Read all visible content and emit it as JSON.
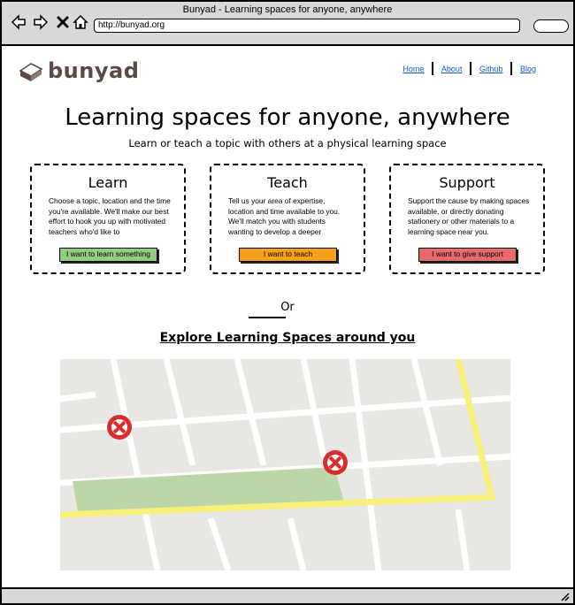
{
  "window": {
    "title": "Bunyad - Learning spaces for anyone, anywhere",
    "url": "http://bunyad.org"
  },
  "header": {
    "logo_text": "bunyad",
    "logo_color": "#5a4a45",
    "nav": [
      {
        "label": "Home"
      },
      {
        "label": "About"
      },
      {
        "label": "Github"
      },
      {
        "label": "Blog"
      }
    ],
    "link_color": "#1a56c9"
  },
  "hero": {
    "title": "Learning spaces for anyone, anywhere",
    "subtitle": "Learn or teach a topic with others at a physical learning space"
  },
  "cards": [
    {
      "title": "Learn",
      "body": "Choose a topic, location and the time you're available. We'll make our best effort to hook you up with motivated teachers who'd like to",
      "button": "I want to learn something",
      "button_color": "#8fcf7d"
    },
    {
      "title": "Teach",
      "body": "Tell us your area of expertise, location and time available to you. We'll match you with students wanting to develop a deeper",
      "button": "I want to teach",
      "button_color": "#f7a11a"
    },
    {
      "title": "Support",
      "body": "Support the cause by making spaces available, or directly donating stationery or other materials to a learning space near you.",
      "button": "I want to give support",
      "button_color": "#e96a6a"
    }
  ],
  "divider": {
    "label": "Or"
  },
  "explore": {
    "heading": "Explore Learning Spaces around you"
  },
  "map": {
    "background_color": "#e9e7e3",
    "road_color": "#ffffff",
    "highway_color": "#f7f07a",
    "park_color": "#bcd6a8",
    "marker_color": "#d92d2d",
    "markers": [
      {
        "name": "learning-space-marker-1"
      },
      {
        "name": "learning-space-marker-2"
      }
    ]
  }
}
